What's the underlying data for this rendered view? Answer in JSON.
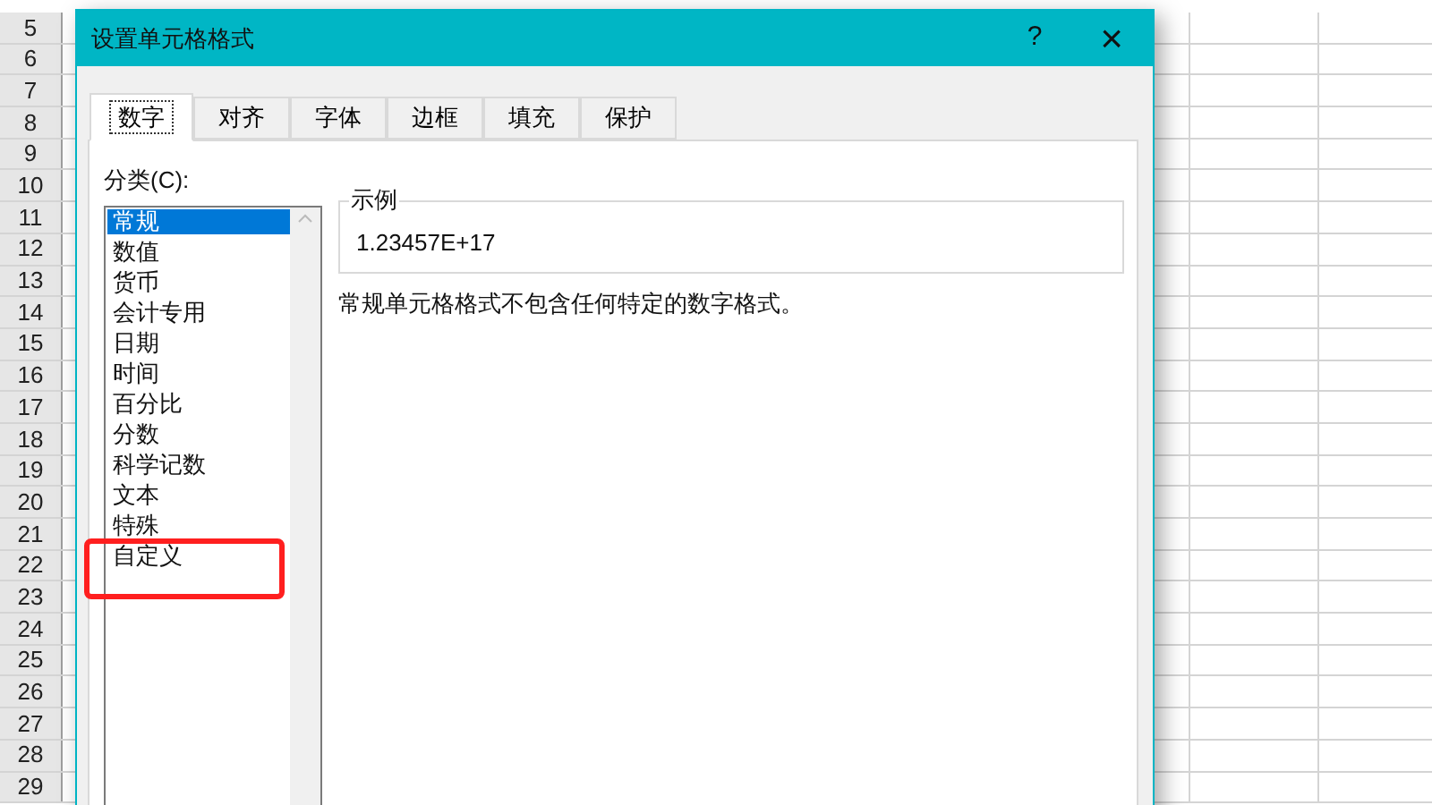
{
  "sheet": {
    "row_numbers": [
      "5",
      "6",
      "7",
      "8",
      "9",
      "10",
      "11",
      "12",
      "13",
      "14",
      "15",
      "16",
      "17",
      "18",
      "19",
      "20",
      "21",
      "22",
      "23",
      "24",
      "25",
      "26",
      "27",
      "28",
      "29"
    ]
  },
  "dialog": {
    "title": "设置单元格格式",
    "help": "?",
    "close": "×",
    "tabs": [
      {
        "label": "数字",
        "selected": true
      },
      {
        "label": "对齐",
        "selected": false
      },
      {
        "label": "字体",
        "selected": false
      },
      {
        "label": "边框",
        "selected": false
      },
      {
        "label": "填充",
        "selected": false
      },
      {
        "label": "保护",
        "selected": false
      }
    ],
    "category_label": "分类(C):",
    "categories": [
      {
        "label": "常规",
        "selected": true
      },
      {
        "label": "数值",
        "selected": false
      },
      {
        "label": "货币",
        "selected": false
      },
      {
        "label": "会计专用",
        "selected": false
      },
      {
        "label": "日期",
        "selected": false
      },
      {
        "label": "时间",
        "selected": false
      },
      {
        "label": "百分比",
        "selected": false
      },
      {
        "label": "分数",
        "selected": false
      },
      {
        "label": "科学记数",
        "selected": false
      },
      {
        "label": "文本",
        "selected": false
      },
      {
        "label": "特殊",
        "selected": false
      },
      {
        "label": "自定义",
        "selected": false
      }
    ],
    "sample_label": "示例",
    "sample_value": "1.23457E+17",
    "description": "常规单元格格式不包含任何特定的数字格式。"
  }
}
